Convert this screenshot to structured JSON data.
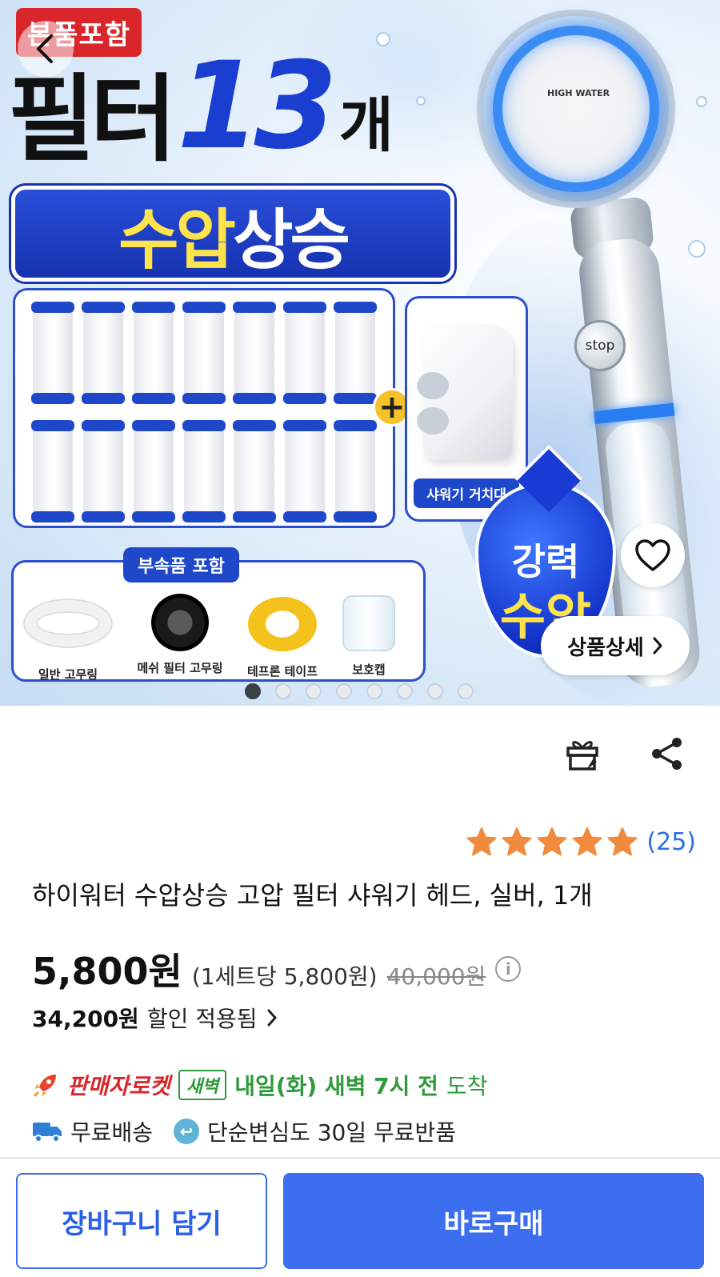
{
  "hero": {
    "badge": "본품포함",
    "title_word": "필터",
    "title_number": "13",
    "title_unit": "개",
    "banner_yellow": "수압",
    "banner_white": "상승",
    "shower_brand": "HIGH WATER",
    "stop_label": "stop",
    "holder_label": "샤워기 거치대",
    "accessories_title": "부속품 포함",
    "accessories": [
      {
        "label": "일반 고무링"
      },
      {
        "label": "메쉬 필터 고무링"
      },
      {
        "label": "테프론 테이프"
      },
      {
        "label": "보호캡"
      }
    ],
    "power_line1": "강력",
    "power_line2": "수압",
    "filter_count": 14,
    "detail_button": "상품상세",
    "carousel_total": 8,
    "carousel_active": 1
  },
  "product": {
    "rating_count": "(25)",
    "rating_stars": 5,
    "title": "하이워터 수압상승 고압 필터 샤워기 헤드, 실버, 1개",
    "price": "5,800원",
    "unit_price": "(1세트당 5,800원)",
    "original_price": "40,000원",
    "discount_amount": "34,200원",
    "discount_text": "할인 적용됨",
    "rocket_label": "판매자로켓",
    "dawn_badge": "새벽",
    "delivery_eta": "내일(화) 새벽 7시 전",
    "delivery_arrive": "도착",
    "free_shipping": "무료배송",
    "free_return": "단순변심도 30일 무료반품"
  },
  "actions": {
    "cart": "장바구니 담기",
    "buy": "바로구매"
  },
  "colors": {
    "brand_blue": "#3d6ef0",
    "rating_star": "#f08a3c",
    "rocket_red": "#d8262b",
    "dawn_green": "#2f9a3b"
  }
}
